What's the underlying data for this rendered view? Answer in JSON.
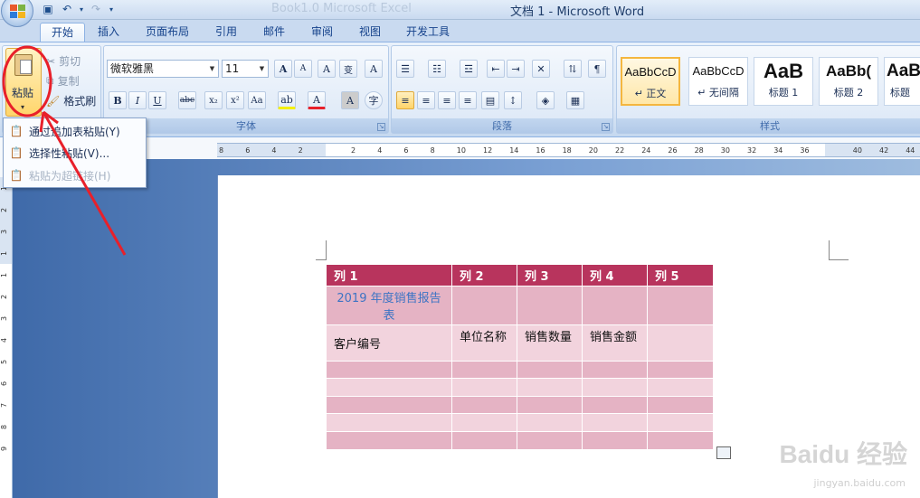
{
  "window": {
    "title": "文档 1 - Microsoft Word",
    "faded_title": "Book1.0 Microsoft Excel"
  },
  "qat": {
    "icons": [
      "save-icon",
      "undo-icon",
      "redo-icon"
    ]
  },
  "tabs": [
    "开始",
    "插入",
    "页面布局",
    "引用",
    "邮件",
    "审阅",
    "视图",
    "开发工具"
  ],
  "active_tab": "开始",
  "clipboard": {
    "paste_label": "粘贴",
    "cut_label": "剪切",
    "copy_label": "复制",
    "format_painter_label": "格式刷"
  },
  "font": {
    "group_label": "字体",
    "font_name": "微软雅黑",
    "font_size": "11",
    "bold": "B",
    "italic": "I",
    "underline": "U",
    "strike": "abc",
    "subscript": "x₂",
    "superscript": "x²",
    "change_case": "Aa",
    "grow": "A",
    "shrink": "A",
    "clear": "A",
    "phonetic": "变",
    "border_char": "A",
    "enclose": "字"
  },
  "paragraph": {
    "group_label": "段落"
  },
  "styles": {
    "group_label": "样式",
    "items": [
      {
        "sample": "AaBbCcD",
        "name": "↵ 正文",
        "selected": true
      },
      {
        "sample": "AaBbCcD",
        "name": "↵ 无间隔",
        "selected": false
      },
      {
        "sample": "AaB",
        "name": "标题 1",
        "selected": false
      },
      {
        "sample": "AaBb(",
        "name": "标题 2",
        "selected": false
      },
      {
        "sample": "AaB",
        "name": "标题",
        "selected": false
      }
    ]
  },
  "paste_menu": {
    "items": [
      {
        "label": "通过追加表粘贴(Y)",
        "enabled": true
      },
      {
        "label": "选择性粘贴(V)...",
        "enabled": true
      },
      {
        "label": "粘贴为超链接(H)",
        "enabled": false
      }
    ]
  },
  "ruler": {
    "h_ticks": [
      "8",
      "6",
      "4",
      "2",
      "",
      "2",
      "4",
      "6",
      "8",
      "10",
      "12",
      "14",
      "16",
      "18",
      "20",
      "22",
      "24",
      "26",
      "28",
      "30",
      "32",
      "34",
      "36",
      "",
      "40",
      "42",
      "44"
    ],
    "v_ticks": [
      "1",
      "2",
      "3",
      "1",
      "1",
      "2",
      "3",
      "4",
      "5",
      "6",
      "7",
      "8",
      "9"
    ]
  },
  "table": {
    "headers": [
      "列 1",
      "列 2",
      "列 3",
      "列 4",
      "列 5"
    ],
    "rows": [
      [
        "2019 年度销售报告表",
        "",
        "",
        "",
        ""
      ],
      [
        "客户编号",
        "单位名称",
        "销售数量",
        "销售金额",
        ""
      ],
      [
        "",
        "",
        "",
        "",
        ""
      ],
      [
        "",
        "",
        "",
        "",
        ""
      ],
      [
        "",
        "",
        "",
        "",
        ""
      ],
      [
        "",
        "",
        "",
        "",
        ""
      ],
      [
        "",
        "",
        "",
        "",
        ""
      ]
    ]
  },
  "watermark": {
    "brand": "Baidu 经验",
    "url": "jingyan.baidu.com"
  },
  "colors": {
    "accent_red": "#e8202a",
    "table_header": "#b8345d",
    "ribbon": "#dbe7f6",
    "link_blue": "#3d74c4"
  }
}
